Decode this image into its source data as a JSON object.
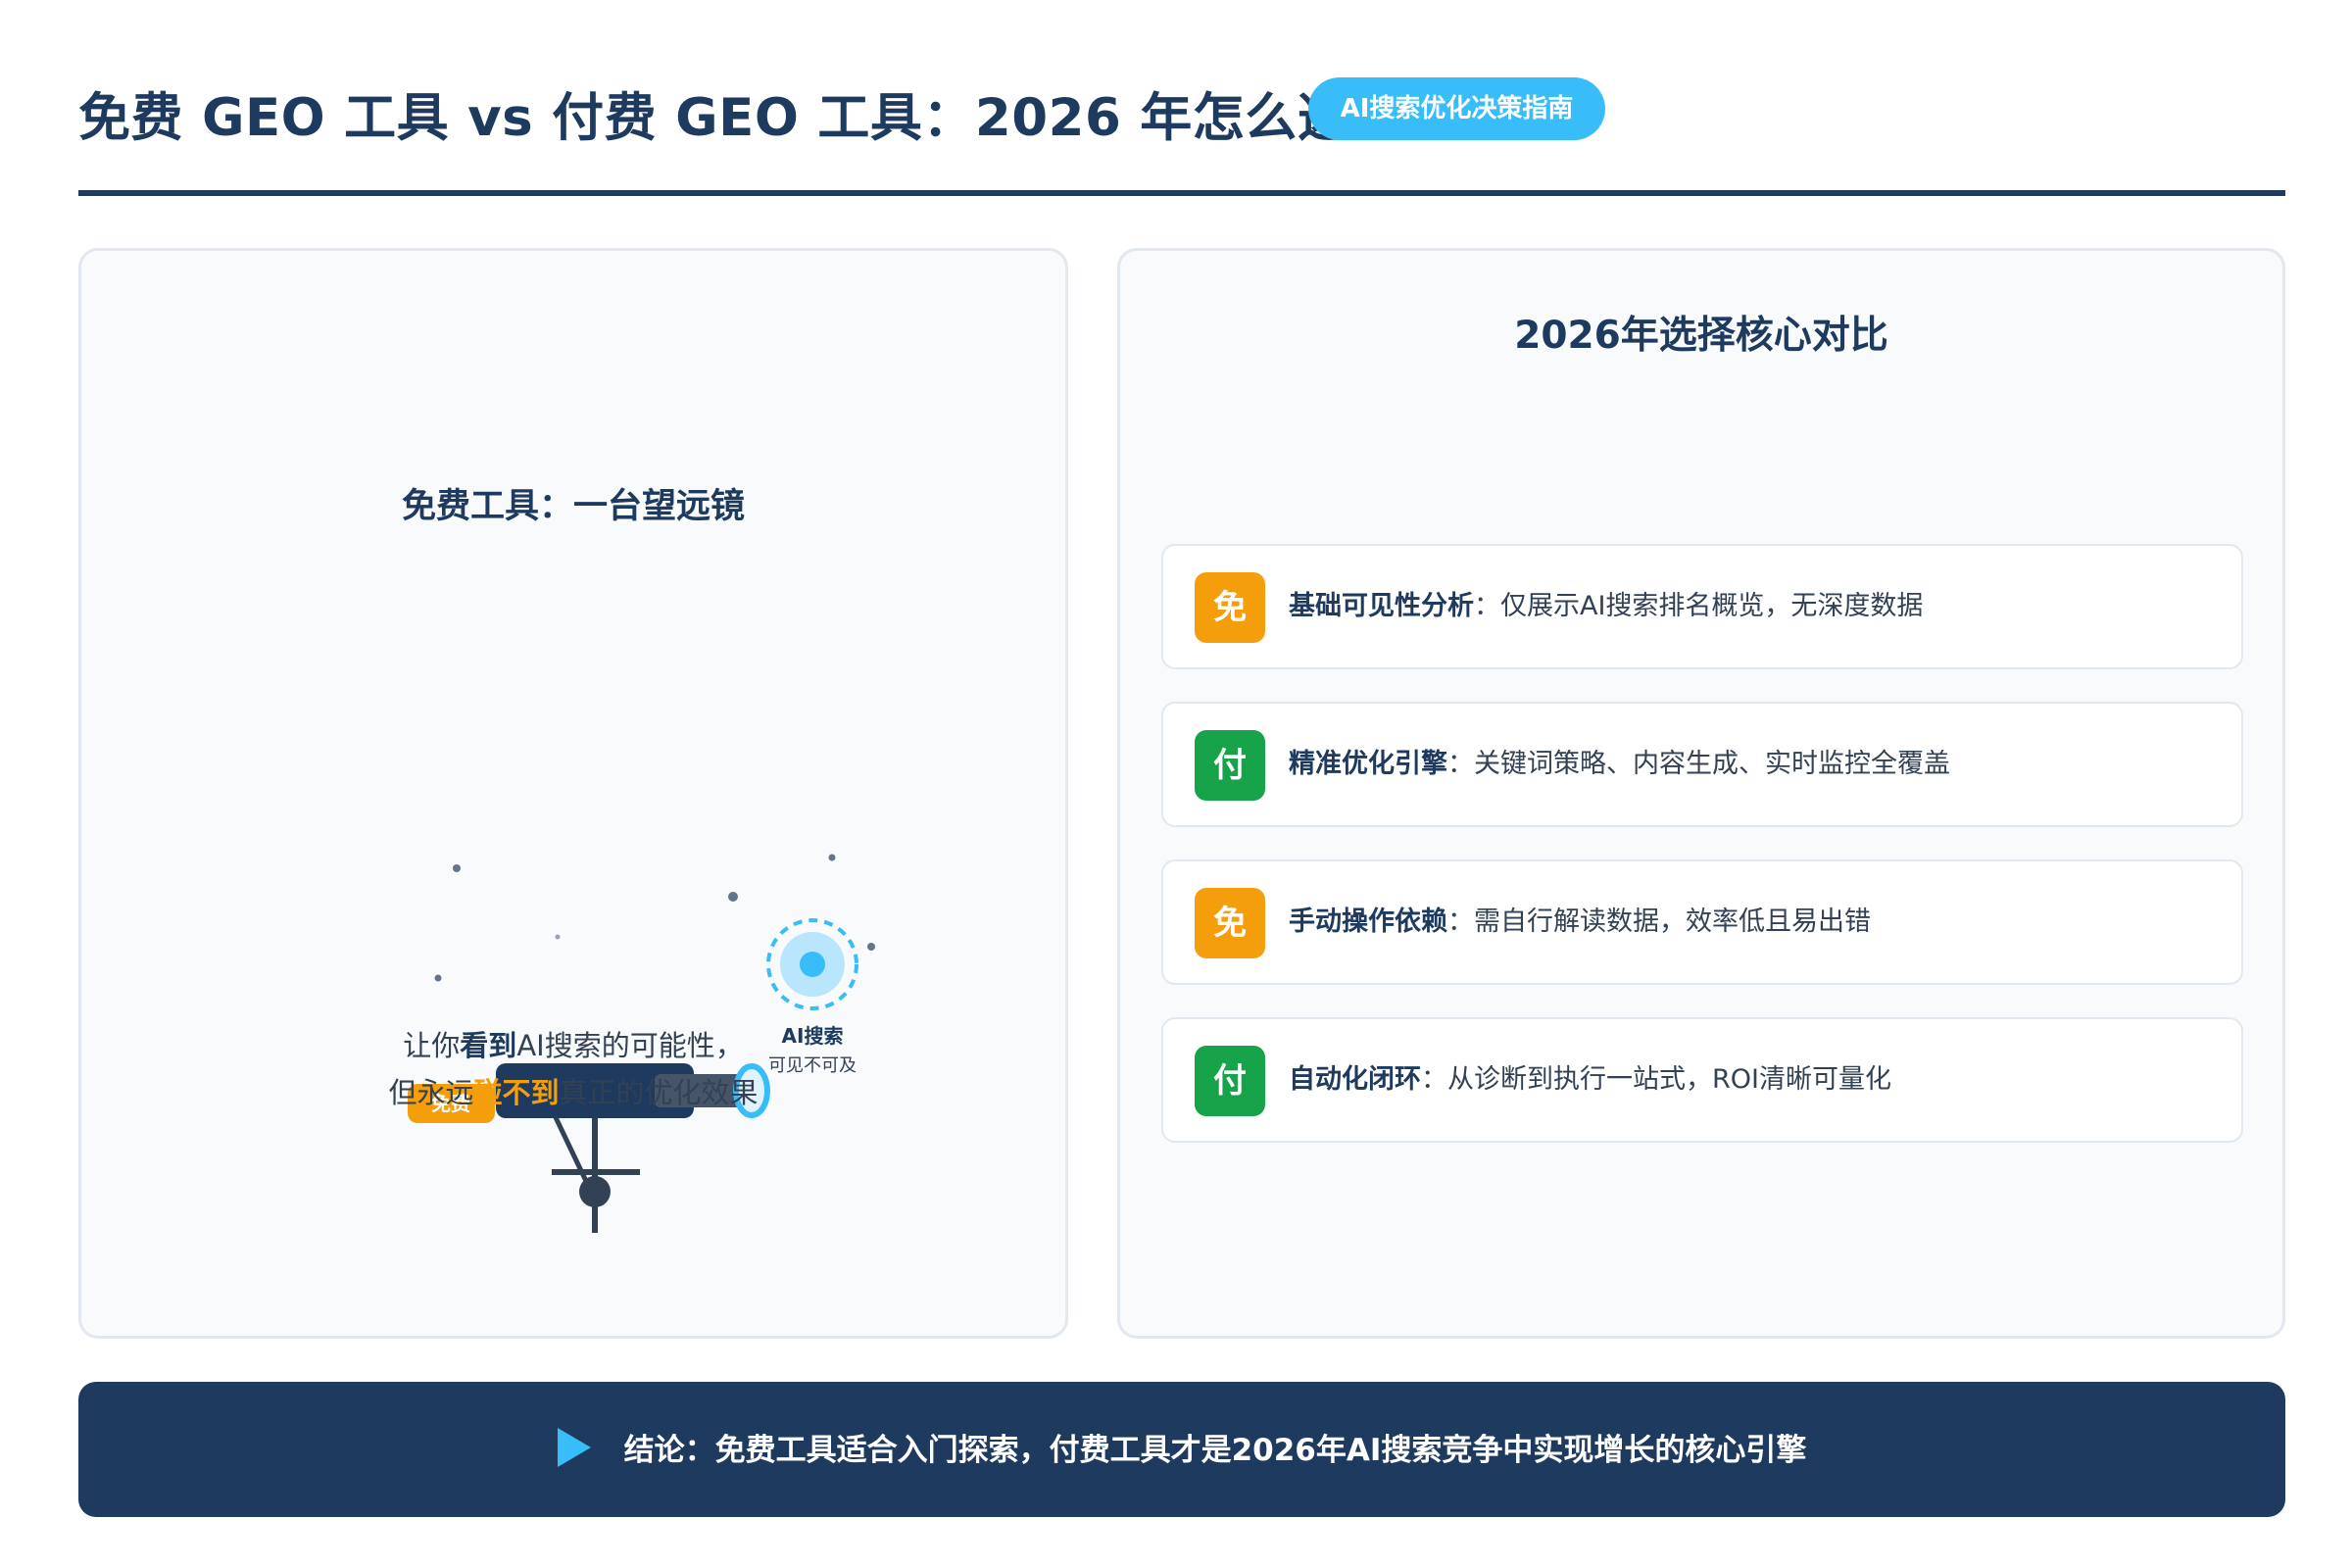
{
  "header": {
    "title": "免费 GEO 工具 vs 付费 GEO 工具：2026 年怎么选?",
    "badge": "AI搜索优化决策指南"
  },
  "left_panel": {
    "heading": "免费工具：一台望远镜",
    "illustration": {
      "tag": "免费",
      "target_label": "AI搜索",
      "target_sub": "可见不可及"
    },
    "caption": {
      "line1_pre": "让你",
      "line1_strong": "看到",
      "line1_post": "AI搜索的可能性，",
      "line2_pre": "但永远",
      "line2_strong": "碰不到",
      "line2_post": "真正的优化效果"
    }
  },
  "right_panel": {
    "heading": "2026年选择核心对比",
    "items": [
      {
        "badge": "免",
        "kind": "free",
        "title": "基础可见性分析",
        "text": "：仅展示AI搜索排名概览，无深度数据"
      },
      {
        "badge": "付",
        "kind": "paid",
        "title": "精准优化引擎",
        "text": "：关键词策略、内容生成、实时监控全覆盖"
      },
      {
        "badge": "免",
        "kind": "free",
        "title": "手动操作依赖",
        "text": "：需自行解读数据，效率低且易出错"
      },
      {
        "badge": "付",
        "kind": "paid",
        "title": "自动化闭环",
        "text": "：从诊断到执行一站式，ROI清晰可量化"
      }
    ]
  },
  "footer": {
    "text": "结论：免费工具适合入门探索，付费工具才是2026年AI搜索竞争中实现增长的核心引擎"
  },
  "colors": {
    "navy": "#1e3a5f",
    "sky": "#38bdf8",
    "orange": "#f59e0b",
    "green": "#16a34a"
  }
}
